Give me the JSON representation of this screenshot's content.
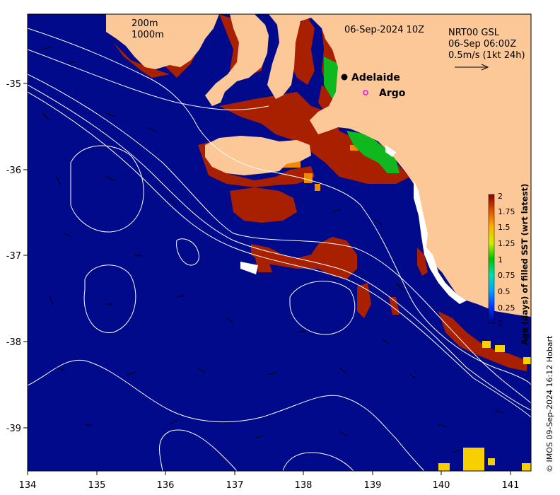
{
  "title": {
    "datetime": "06-Sep-2024 10Z"
  },
  "isobaths": {
    "label_200": "200m",
    "label_1000": "1000m"
  },
  "currents": {
    "source": "NRT00 GSL",
    "time": "06-Sep 06:00Z",
    "scale": "0.5m/s (1kt 24h)"
  },
  "places": [
    {
      "name": "Adelaide",
      "marker": "filled-dot",
      "lon": 138.6,
      "lat": -34.93
    },
    {
      "name": "Argo",
      "marker": "magenta-circle",
      "lon": 138.8,
      "lat": -35.12
    }
  ],
  "axes": {
    "x_ticks": [
      "134",
      "135",
      "136",
      "137",
      "138",
      "139",
      "140",
      "141"
    ],
    "y_ticks": [
      "-35",
      "-36",
      "-37",
      "-38",
      "-39"
    ],
    "xlim": [
      134,
      141.3
    ],
    "ylim": [
      -39.5,
      -34.2
    ]
  },
  "colorbar": {
    "title": "Age (days) of filled SST (wrt latest)",
    "ticks": [
      "0",
      "0.25",
      "0.5",
      "0.75",
      "1",
      "1.25",
      "1.5",
      "1.75",
      "2"
    ],
    "range": [
      0,
      2
    ]
  },
  "credit": "© IMOS 09-Sep-2024 16:12 Hobart",
  "colors": {
    "ocean": "#000a8a",
    "land": "#fdc897",
    "age_old": "#b02000",
    "contour": "#ffffff"
  }
}
